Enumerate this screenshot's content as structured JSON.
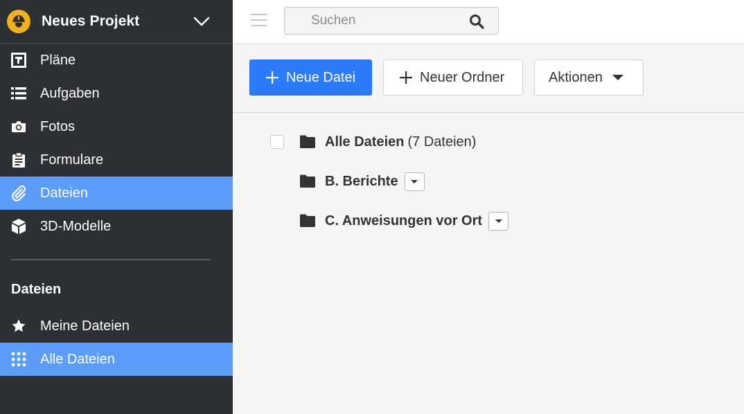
{
  "project": {
    "title": "Neues Projekt",
    "logo_icon": "hardhat-worker-icon"
  },
  "nav": [
    {
      "label": "Pläne",
      "icon": "blueprint-icon",
      "active": false
    },
    {
      "label": "Aufgaben",
      "icon": "list-icon",
      "active": false
    },
    {
      "label": "Fotos",
      "icon": "camera-icon",
      "active": false
    },
    {
      "label": "Formulare",
      "icon": "clipboard-icon",
      "active": false
    },
    {
      "label": "Dateien",
      "icon": "paperclip-icon",
      "active": true
    },
    {
      "label": "3D-Modelle",
      "icon": "cube-icon",
      "active": false
    }
  ],
  "files_section": {
    "title": "Dateien",
    "items": [
      {
        "label": "Meine Dateien",
        "icon": "star-icon",
        "active": false
      },
      {
        "label": "Alle Dateien",
        "icon": "grid-icon",
        "active": true
      }
    ]
  },
  "search": {
    "placeholder": "Suchen"
  },
  "toolbar": {
    "new_file_label": "Neue Datei",
    "new_folder_label": "Neuer Ordner",
    "actions_label": "Aktionen"
  },
  "tree": {
    "root": {
      "label": "Alle Dateien",
      "count": "(7 Dateien)"
    },
    "folders": [
      {
        "label": "B. Berichte"
      },
      {
        "label": "C. Anweisungen vor Ort"
      }
    ]
  },
  "colors": {
    "sidebar_bg": "#2c2f33",
    "active_item": "#5c9cfa",
    "primary_button": "#2b7bfa",
    "logo": "#f3b21b"
  }
}
